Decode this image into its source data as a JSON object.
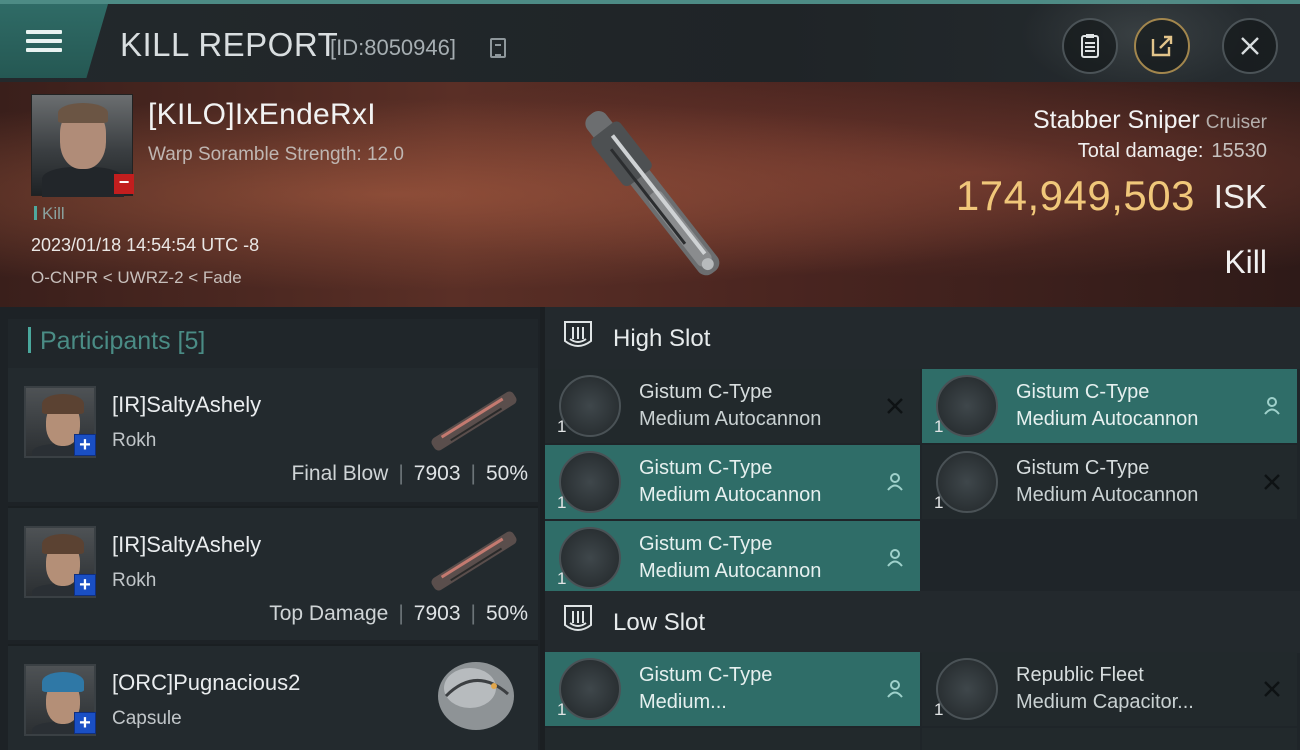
{
  "header": {
    "title": "KILL REPORT",
    "id_label": "[ID:8050946]"
  },
  "victim": {
    "name": "[KILO]IxEndeRxI",
    "scramble": "Warp Soramble Strength: 12.0",
    "kill_tag": "Kill",
    "datetime": "2023/01/18 14:54:54 UTC -8",
    "location": "O-CNPR < UWRZ-2 < Fade"
  },
  "ship": {
    "name": "Stabber Sniper",
    "class": "Cruiser",
    "total_damage_label": "Total damage:",
    "total_damage_value": "15530",
    "isk_value": "174,949,503",
    "isk_unit": "ISK",
    "result": "Kill"
  },
  "participants": {
    "title": "Participants [5]",
    "rows": [
      {
        "name": "[IR]SaltyAshely",
        "ship": "Rokh",
        "role": "Final Blow",
        "damage": "7903",
        "percent": "50%"
      },
      {
        "name": "[IR]SaltyAshely",
        "ship": "Rokh",
        "role": "Top Damage",
        "damage": "7903",
        "percent": "50%"
      },
      {
        "name": "[ORC]Pugnacious2",
        "ship": "Capsule"
      }
    ]
  },
  "slots": {
    "high": {
      "title": "High Slot",
      "modules": [
        {
          "qty": "1",
          "line1": "Gistum C-Type",
          "line2": "Medium Autocannon",
          "state": "destroyed"
        },
        {
          "qty": "1",
          "line1": "Gistum C-Type",
          "line2": "Medium Autocannon",
          "state": "dropped"
        },
        {
          "qty": "1",
          "line1": "Gistum C-Type",
          "line2": "Medium Autocannon",
          "state": "dropped"
        },
        {
          "qty": "1",
          "line1": "Gistum C-Type",
          "line2": "Medium Autocannon",
          "state": "destroyed"
        },
        {
          "qty": "1",
          "line1": "Gistum C-Type",
          "line2": "Medium Autocannon",
          "state": "dropped"
        }
      ]
    },
    "low": {
      "title": "Low Slot",
      "modules": [
        {
          "qty": "1",
          "line1": "Gistum C-Type",
          "line2": "Medium...",
          "state": "dropped"
        },
        {
          "qty": "1",
          "line1": "Republic Fleet",
          "line2": "Medium Capacitor...",
          "state": "destroyed"
        }
      ]
    }
  },
  "colors": {
    "accent": "#2f6d68",
    "isk": "#f0c77a",
    "danger": "#c21e1e",
    "badge": "#1a4fc4"
  }
}
